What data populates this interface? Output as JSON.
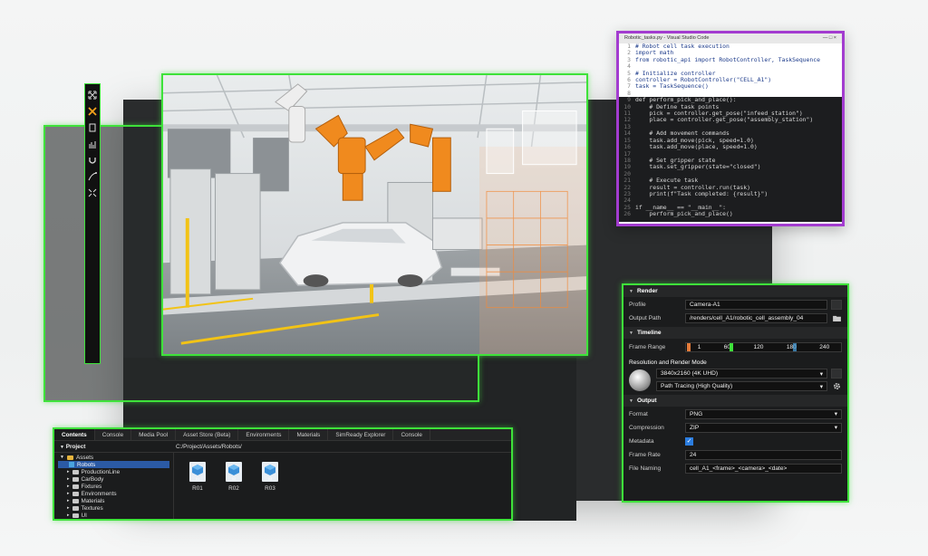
{
  "colors": {
    "highlight_green": "#3ee23a",
    "editor_purple": "#a33cd0",
    "accent_blue": "#2b5aa5"
  },
  "toolbar": {
    "icons": [
      "expand-icon",
      "crosshair-icon",
      "document-icon",
      "chart-icon",
      "magnet-icon",
      "path-icon",
      "collapse-icon"
    ]
  },
  "code_editor": {
    "title": "Robotic_tasks.py - Visual Studio Code",
    "window_controls": "— □ ×",
    "light_lines": [
      {
        "n": "1",
        "t": "# Robot cell task execution"
      },
      {
        "n": "2",
        "t": "import math"
      },
      {
        "n": "3",
        "t": "from robotic_api import RobotController, TaskSequence"
      },
      {
        "n": "4",
        "t": ""
      },
      {
        "n": "5",
        "t": "# Initialize controller"
      },
      {
        "n": "6",
        "t": "controller = RobotController(\"CELL_A1\")"
      },
      {
        "n": "7",
        "t": "task = TaskSequence()"
      },
      {
        "n": "8",
        "t": ""
      }
    ],
    "dark_lines": [
      {
        "n": "9",
        "t": "def perform_pick_and_place():"
      },
      {
        "n": "10",
        "t": "    # Define task points"
      },
      {
        "n": "11",
        "t": "    pick = controller.get_pose(\"infeed_station\")"
      },
      {
        "n": "12",
        "t": "    place = controller.get_pose(\"assembly_station\")"
      },
      {
        "n": "13",
        "t": ""
      },
      {
        "n": "14",
        "t": "    # Add movement commands"
      },
      {
        "n": "15",
        "t": "    task.add_move(pick, speed=1.0)"
      },
      {
        "n": "16",
        "t": "    task.add_move(place, speed=1.0)"
      },
      {
        "n": "17",
        "t": ""
      },
      {
        "n": "18",
        "t": "    # Set gripper state"
      },
      {
        "n": "19",
        "t": "    task.set_gripper(state=\"closed\")"
      },
      {
        "n": "20",
        "t": ""
      },
      {
        "n": "21",
        "t": "    # Execute task"
      },
      {
        "n": "22",
        "t": "    result = controller.run(task)"
      },
      {
        "n": "23",
        "t": "    print(f\"Task completed: {result}\")"
      },
      {
        "n": "24",
        "t": ""
      },
      {
        "n": "25",
        "t": "if __name__ == \"__main__\":"
      },
      {
        "n": "26",
        "t": "    perform_pick_and_place()"
      }
    ]
  },
  "render_panel": {
    "render_title": "Render",
    "profile_label": "Profile",
    "profile_value": "Camera-A1",
    "output_path_label": "Output Path",
    "output_path_value": "/renders/cell_A1/robotic_cell_assembly_04",
    "timeline_title": "Timeline",
    "frame_range_label": "Frame Range",
    "frame_ticks": [
      "1",
      "60",
      "120",
      "180",
      "240"
    ],
    "resolution_title": "Resolution and Render Mode",
    "resolution_value": "3840x2160 (4K UHD)",
    "render_mode_value": "Path Tracing (High Quality)",
    "output_title": "Output",
    "format_label": "Format",
    "format_value": "PNG",
    "compression_label": "Compression",
    "compression_value": "ZIP",
    "metadata_label": "Metadata",
    "metadata_checked": true,
    "frame_rate_label": "Frame Rate",
    "frame_rate_value": "24",
    "file_naming_label": "File Naming",
    "file_naming_value": "cell_A1_<frame>_<camera>_<date>"
  },
  "contents_browser": {
    "tabs": [
      "Contents",
      "Console",
      "Media Pool",
      "Asset Store (Beta)",
      "Environments",
      "Materials",
      "SimReady Explorer",
      "Console"
    ],
    "project_label": "Project",
    "path": "C:/Project/Assets/Robots/",
    "tree": [
      {
        "label": "Assets",
        "type": "folder-open"
      },
      {
        "label": "Robots",
        "type": "selected"
      },
      {
        "label": "ProductionLine",
        "type": "folder"
      },
      {
        "label": "CarBody",
        "type": "folder"
      },
      {
        "label": "Fixtures",
        "type": "folder"
      },
      {
        "label": "Environments",
        "type": "folder"
      },
      {
        "label": "Materials",
        "type": "folder"
      },
      {
        "label": "Textures",
        "type": "folder"
      },
      {
        "label": "UI",
        "type": "folder"
      }
    ],
    "assets": [
      {
        "name": "R01",
        "icon_text": "01"
      },
      {
        "name": "R02",
        "icon_text": "02"
      },
      {
        "name": "R03",
        "icon_text": "03"
      }
    ]
  }
}
